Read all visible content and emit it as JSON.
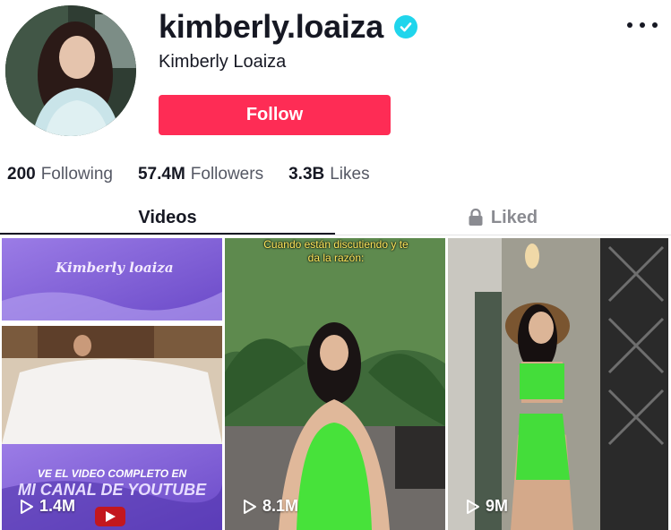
{
  "profile": {
    "username": "kimberly.loaiza",
    "display_name": "Kimberly Loaiza",
    "follow_label": "Follow",
    "verified_icon": "verified-check-icon",
    "more_icon": "more-dots-icon"
  },
  "stats": {
    "following": {
      "value": "200",
      "label": "Following"
    },
    "followers": {
      "value": "57.4M",
      "label": "Followers"
    },
    "likes": {
      "value": "3.3B",
      "label": "Likes"
    }
  },
  "tabs": {
    "videos": "Videos",
    "liked": "Liked",
    "liked_icon": "lock-icon"
  },
  "videos": [
    {
      "views": "1.4M",
      "brand": "Kimberly loaiza",
      "line1": "VE EL VIDEO COMPLETO EN",
      "line2": "MI CANAL DE YOUTUBE"
    },
    {
      "views": "8.1M",
      "caption": "Cuando están discutiendo y te da la razón:"
    },
    {
      "views": "9M"
    }
  ],
  "colors": {
    "follow_bg": "#fe2c55",
    "verified": "#20d5ec",
    "text_primary": "#161823",
    "text_secondary": "#8a8b91"
  }
}
